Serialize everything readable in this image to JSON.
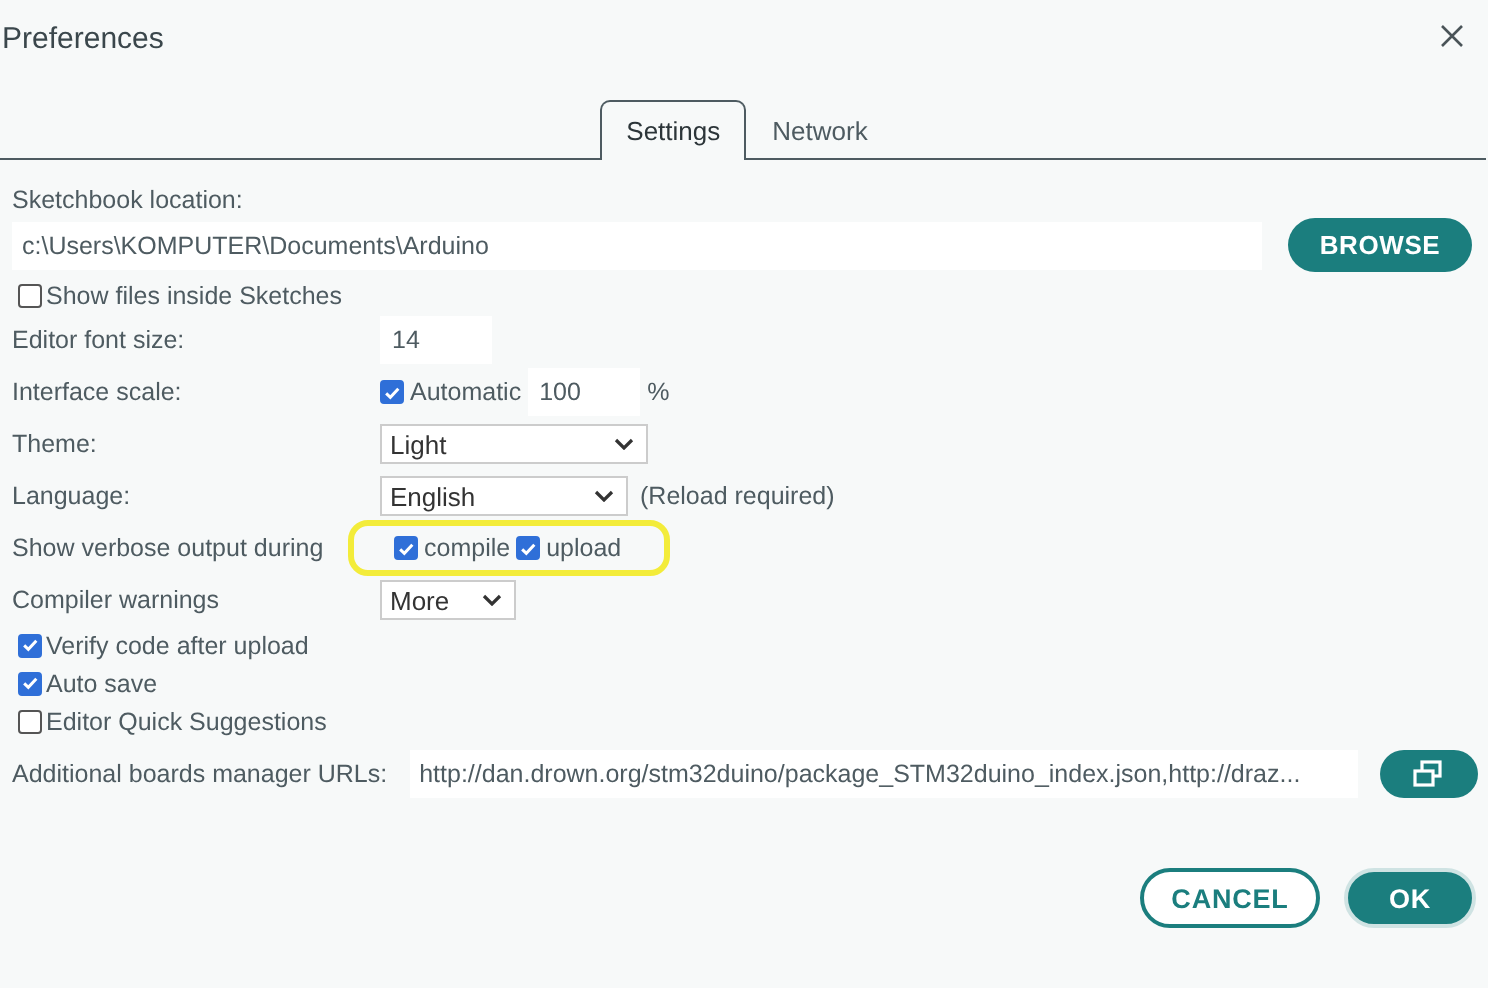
{
  "window": {
    "title": "Preferences"
  },
  "tabs": [
    {
      "label": "Settings",
      "selected": true
    },
    {
      "label": "Network",
      "selected": false
    }
  ],
  "settings": [
    {
      "kind": "path",
      "label": "Sketchbook location:",
      "value": "c:\\Users\\KOMPUTER\\Documents\\Arduino",
      "button": "BROWSE"
    },
    {
      "kind": "checkbox",
      "label": "Show files inside Sketches",
      "checked": false
    },
    {
      "kind": "number",
      "label": "Editor font size:",
      "value": "14"
    },
    {
      "kind": "scale",
      "label": "Interface scale:",
      "checkbox_label": "Automatic",
      "checked": true,
      "value": "100",
      "unit": "%"
    },
    {
      "kind": "select",
      "label": "Theme:",
      "value": "Light"
    },
    {
      "kind": "select",
      "label": "Language:",
      "value": "English",
      "note": "(Reload required)"
    },
    {
      "kind": "checks",
      "label": "Show verbose output during",
      "highlighted": true,
      "options": [
        {
          "label": "compile",
          "checked": true
        },
        {
          "label": "upload",
          "checked": true
        }
      ]
    },
    {
      "kind": "select",
      "label": "Compiler warnings",
      "value": "More"
    },
    {
      "kind": "checkbox",
      "label": "Verify code after upload",
      "checked": true
    },
    {
      "kind": "checkbox",
      "label": "Auto save",
      "checked": true
    },
    {
      "kind": "checkbox",
      "label": "Editor Quick Suggestions",
      "checked": false
    },
    {
      "kind": "urls",
      "label": "Additional boards manager URLs:",
      "value": "http://dan.drown.org/stm32duino/package_STM32duino_index.json,http://draz..."
    }
  ],
  "buttons": [
    {
      "label": "CANCEL",
      "kind": "secondary"
    },
    {
      "label": "OK",
      "kind": "primary"
    }
  ]
}
